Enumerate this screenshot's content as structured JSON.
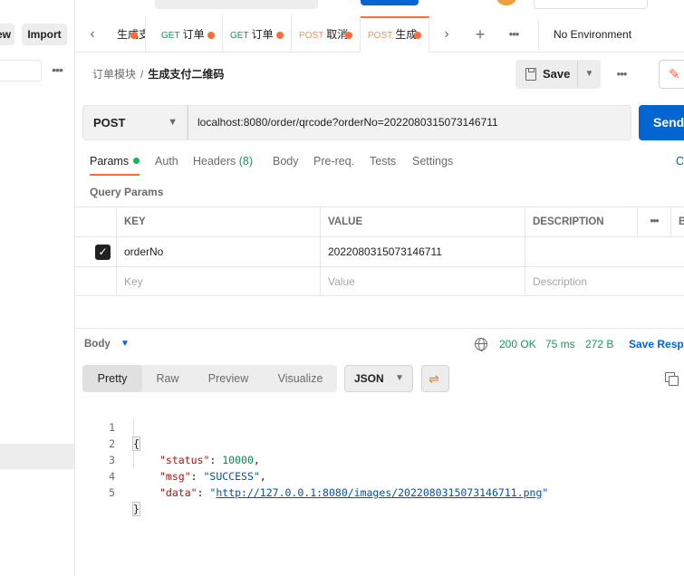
{
  "sidebar": {
    "new_label": "New",
    "import_label": "Import"
  },
  "tabs": [
    {
      "method": "",
      "label": "生成支付二维码"
    },
    {
      "method": "GET",
      "label": "订单"
    },
    {
      "method": "GET",
      "label": "订单"
    },
    {
      "method": "POST",
      "label": "取消"
    },
    {
      "method": "POST",
      "label": "生成"
    }
  ],
  "environment": "No Environment",
  "breadcrumb": {
    "parent": "订单模块",
    "separator": "/",
    "current": "生成支付二维码"
  },
  "toolbar": {
    "save_label": "Save"
  },
  "request": {
    "method": "POST",
    "url": "localhost:8080/order/qrcode?orderNo=2022080315073146711",
    "send_label": "Send"
  },
  "request_tabs": [
    {
      "label": "Params"
    },
    {
      "label": "Auth"
    },
    {
      "label": "Headers ",
      "count": "(8)"
    },
    {
      "label": "Body"
    },
    {
      "label": "Pre-req."
    },
    {
      "label": "Tests"
    },
    {
      "label": "Settings"
    }
  ],
  "cookies_label": "Cookies",
  "query_params": {
    "title": "Query Params",
    "columns": [
      "KEY",
      "VALUE",
      "DESCRIPTION",
      "Bulk Edit"
    ],
    "rows": [
      {
        "checked": true,
        "key": "orderNo",
        "value": "2022080315073146711",
        "description": ""
      }
    ],
    "placeholder": {
      "key": "Key",
      "value": "Value",
      "description": "Description"
    }
  },
  "response": {
    "body_label": "Body",
    "status": "200 OK",
    "time": "75 ms",
    "size": "272 B",
    "save_label": "Save Response",
    "view_tabs": [
      "Pretty",
      "Raw",
      "Preview",
      "Visualize"
    ],
    "format": "JSON",
    "lines": [
      {
        "n": "1",
        "open": "{"
      },
      {
        "n": "2",
        "key": "\"status\"",
        "sep": ": ",
        "value": "10000",
        "type": "num",
        "end": ","
      },
      {
        "n": "3",
        "key": "\"msg\"",
        "sep": ": ",
        "value": "\"SUCCESS\"",
        "type": "str",
        "end": ","
      },
      {
        "n": "4",
        "key": "\"data\"",
        "sep": ": ",
        "quote_open": "\"",
        "value": "http://127.0.0.1:8080/images/2022080315073146711.png",
        "quote_close": "\"",
        "type": "link"
      },
      {
        "n": "5",
        "open": "}"
      }
    ]
  },
  "colors": {
    "accent": "#ff6c37",
    "primary": "#0265d2",
    "success": "#0f9d58"
  }
}
